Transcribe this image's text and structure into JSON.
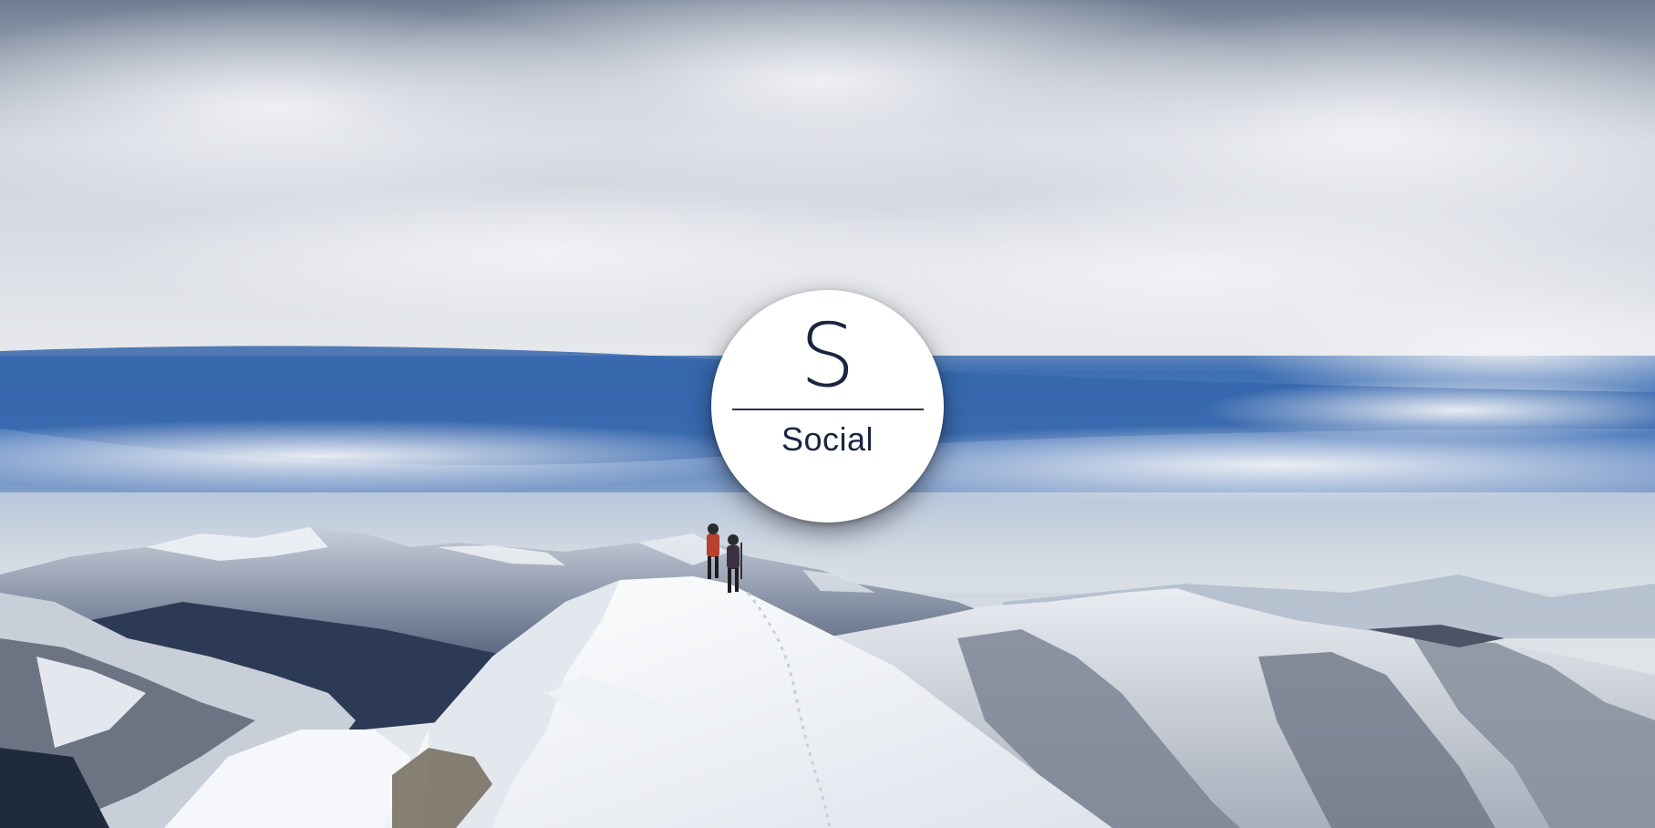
{
  "background": {
    "scene": "snowy-mountain-ridge-with-climbers",
    "sky_color": "#3a6fb8",
    "cloud_color": "#dfe3ea",
    "snow_color": "#f4f6f9",
    "rock_color": "#4a5060"
  },
  "logo": {
    "letter": "S",
    "word": "Social",
    "badge_color": "#ffffff",
    "text_color": "#1a2540"
  }
}
